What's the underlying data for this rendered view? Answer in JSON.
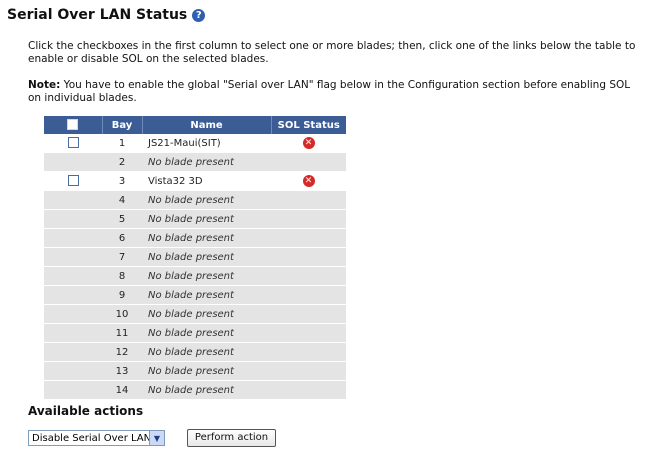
{
  "page": {
    "title": "Serial Over LAN Status",
    "instructions": "Click the checkboxes in the first column to select one or more blades; then, click one of the links below the table to enable or disable SOL on the selected blades.",
    "note_label": "Note:",
    "note_text": " You have to enable the global \"Serial over LAN\" flag below in the Configuration section before enabling SOL on individual blades."
  },
  "table": {
    "headers": {
      "bay": "Bay",
      "name": "Name",
      "sol": "SOL Status"
    },
    "rows": [
      {
        "bay": "1",
        "name": "JS21-Maui(SIT)",
        "present": true,
        "sol": "error"
      },
      {
        "bay": "2",
        "name": "No blade present",
        "present": false
      },
      {
        "bay": "3",
        "name": "Vista32 3D",
        "present": true,
        "sol": "error"
      },
      {
        "bay": "4",
        "name": "No blade present",
        "present": false
      },
      {
        "bay": "5",
        "name": "No blade present",
        "present": false
      },
      {
        "bay": "6",
        "name": "No blade present",
        "present": false
      },
      {
        "bay": "7",
        "name": "No blade present",
        "present": false
      },
      {
        "bay": "8",
        "name": "No blade present",
        "present": false
      },
      {
        "bay": "9",
        "name": "No blade present",
        "present": false
      },
      {
        "bay": "10",
        "name": "No blade present",
        "present": false
      },
      {
        "bay": "11",
        "name": "No blade present",
        "present": false
      },
      {
        "bay": "12",
        "name": "No blade present",
        "present": false
      },
      {
        "bay": "13",
        "name": "No blade present",
        "present": false
      },
      {
        "bay": "14",
        "name": "No blade present",
        "present": false
      }
    ]
  },
  "actions": {
    "title": "Available actions",
    "selected": "Disable Serial Over LAN",
    "button_label": "Perform action"
  },
  "icons": {
    "help": "help-question-icon",
    "sol_error": "error-x-icon",
    "dropdown": "chevron-down-icon"
  },
  "colors": {
    "header_bg": "#3b5c95",
    "row_shaded": "#e4e4e4",
    "error_red": "#d42a2a",
    "help_blue": "#2f5fb3"
  }
}
